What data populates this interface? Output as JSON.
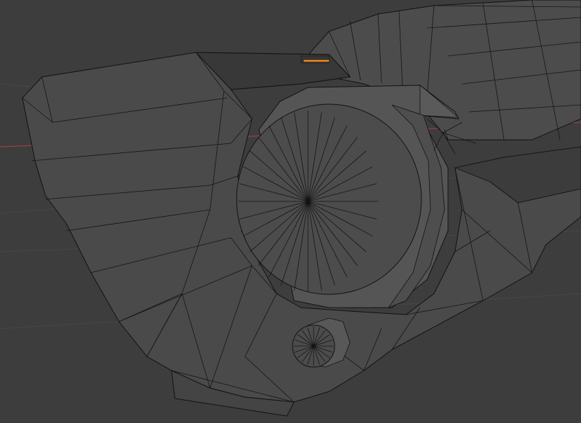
{
  "viewport": {
    "background": "#3d3d3d",
    "mesh_fill": "#4a4a4a",
    "mesh_shadow": "#3a3a3a",
    "mesh_highlight": "#5a5a5a",
    "wire_color": "#141414",
    "selected_edge_color": "#f08a1c",
    "x_axis_color": "#b24a52",
    "grid_color": "#4a4a4a"
  },
  "mesh": {
    "mode": "edit-mode-wireframe-overlay",
    "selected_edges": 1
  }
}
